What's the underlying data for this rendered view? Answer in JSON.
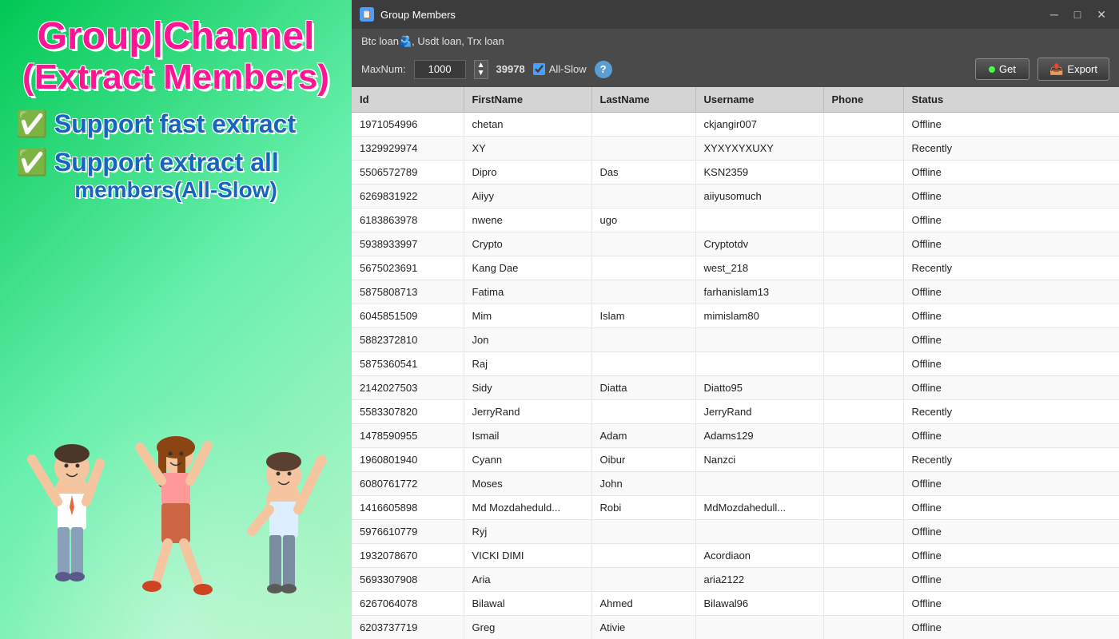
{
  "left": {
    "title_line1": "Group|Channel",
    "title_line2": "(Extract Members)",
    "feature1": "Support fast extract",
    "feature2_line1": "Support extract all",
    "feature2_line2": "members(All-Slow)"
  },
  "window": {
    "icon": "📋",
    "title": "Group Members",
    "controls": {
      "minimize": "─",
      "maximize": "□",
      "close": "✕"
    },
    "group_name": "Btc loan🫂, Usdt loan, Trx loan",
    "toolbar": {
      "maxnum_label": "MaxNum:",
      "maxnum_value": "1000",
      "count": "39978",
      "allslow_label": "All-Slow",
      "allslow_checked": true,
      "get_label": "Get",
      "export_label": "Export"
    }
  },
  "table": {
    "columns": [
      "Id",
      "FirstName",
      "LastName",
      "Username",
      "Phone",
      "Status"
    ],
    "rows": [
      {
        "id": "1971054996",
        "firstname": "chetan",
        "lastname": "",
        "username": "ckjangir007",
        "phone": "",
        "status": "Offline"
      },
      {
        "id": "1329929974",
        "firstname": "XY",
        "lastname": "",
        "username": "XYXYXYXUXY",
        "phone": "",
        "status": "Recently"
      },
      {
        "id": "5506572789",
        "firstname": "Dipro",
        "lastname": "Das",
        "username": "KSN2359",
        "phone": "",
        "status": "Offline"
      },
      {
        "id": "6269831922",
        "firstname": "Aiiyy",
        "lastname": "",
        "username": "aiiyusomuch",
        "phone": "",
        "status": "Offline"
      },
      {
        "id": "6183863978",
        "firstname": "nwene",
        "lastname": "ugo",
        "username": "",
        "phone": "",
        "status": "Offline"
      },
      {
        "id": "5938933997",
        "firstname": "Crypto",
        "lastname": "",
        "username": "Cryptotdv",
        "phone": "",
        "status": "Offline"
      },
      {
        "id": "5675023691",
        "firstname": "Kang Dae",
        "lastname": "",
        "username": "west_218",
        "phone": "",
        "status": "Recently"
      },
      {
        "id": "5875808713",
        "firstname": "Fatima",
        "lastname": "",
        "username": "farhanislam13",
        "phone": "",
        "status": "Offline"
      },
      {
        "id": "6045851509",
        "firstname": "Mim",
        "lastname": "Islam",
        "username": "mimislam80",
        "phone": "",
        "status": "Offline"
      },
      {
        "id": "5882372810",
        "firstname": "Jon",
        "lastname": "",
        "username": "",
        "phone": "",
        "status": "Offline"
      },
      {
        "id": "5875360541",
        "firstname": "Raj",
        "lastname": "",
        "username": "",
        "phone": "",
        "status": "Offline"
      },
      {
        "id": "2142027503",
        "firstname": "Sidy",
        "lastname": "Diatta",
        "username": "Diatto95",
        "phone": "",
        "status": "Offline"
      },
      {
        "id": "5583307820",
        "firstname": "JerryRand",
        "lastname": "",
        "username": "JerryRand",
        "phone": "",
        "status": "Recently"
      },
      {
        "id": "1478590955",
        "firstname": "Ismail",
        "lastname": "Adam",
        "username": "Adams129",
        "phone": "",
        "status": "Offline"
      },
      {
        "id": "1960801940",
        "firstname": "Cyann",
        "lastname": "Oibur",
        "username": "Nanzci",
        "phone": "",
        "status": "Recently"
      },
      {
        "id": "6080761772",
        "firstname": "Moses",
        "lastname": "John",
        "username": "",
        "phone": "",
        "status": "Offline"
      },
      {
        "id": "1416605898",
        "firstname": "Md Mozdaheduld...",
        "lastname": "Robi",
        "username": "MdMozdahedull...",
        "phone": "",
        "status": "Offline"
      },
      {
        "id": "5976610779",
        "firstname": "Ryj",
        "lastname": "",
        "username": "",
        "phone": "",
        "status": "Offline"
      },
      {
        "id": "1932078670",
        "firstname": "VICKI DIMI",
        "lastname": "",
        "username": "Acordiaon",
        "phone": "",
        "status": "Offline"
      },
      {
        "id": "5693307908",
        "firstname": "Aria",
        "lastname": "",
        "username": "aria2122",
        "phone": "",
        "status": "Offline"
      },
      {
        "id": "6267064078",
        "firstname": "Bilawal",
        "lastname": "Ahmed",
        "username": "Bilawal96",
        "phone": "",
        "status": "Offline"
      },
      {
        "id": "6203737719",
        "firstname": "Greg",
        "lastname": "Ativie",
        "username": "",
        "phone": "",
        "status": "Offline"
      }
    ]
  }
}
